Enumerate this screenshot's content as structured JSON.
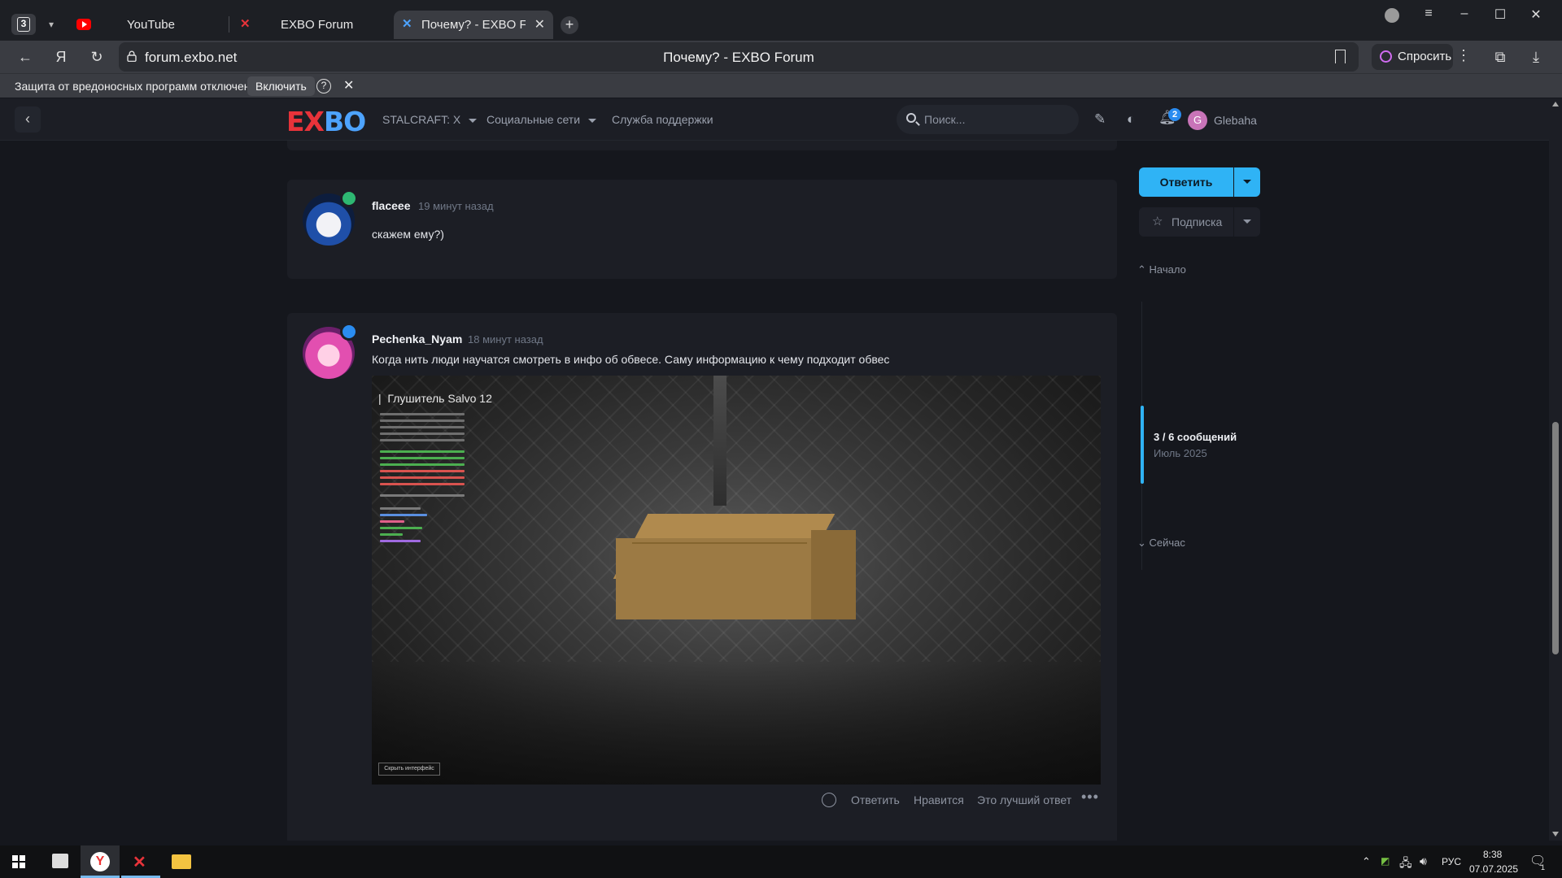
{
  "browser": {
    "tab_counter": "3",
    "tabs": [
      {
        "label": "YouTube"
      },
      {
        "label": "EXBO Forum"
      },
      {
        "label": "Почему? - EXBO Forum"
      }
    ],
    "address": {
      "url": "forum.exbo.net",
      "page_title": "Почему? - EXBO Forum"
    },
    "ask_button": "Спросить",
    "warning": {
      "text": "Защита от вредоносных программ отключена",
      "enable_button": "Включить",
      "help": "?"
    }
  },
  "forum": {
    "logo_left": "EX",
    "logo_right": "BO",
    "nav": [
      {
        "label": "STALCRAFT: X"
      },
      {
        "label": "Социальные сети"
      },
      {
        "label": "Служба поддержки"
      }
    ],
    "search_placeholder": "Поиск...",
    "notifications_count": "2",
    "user": {
      "initial": "G",
      "name": "Glebaha"
    }
  },
  "posts": [
    {
      "author": "flaceee",
      "time": "19 минут назад",
      "text": "скажем ему?)"
    },
    {
      "author": "Pechenka_Nyam",
      "time": "18 минут назад",
      "text": "Когда нить люди научатся смотреть в инфо об обвесе. Саму информацию к чему подходит обвес",
      "image": {
        "hud_title": "Глушитель Salvo 12",
        "hud_button": "Скрыть интерфейс"
      },
      "actions": [
        "Ответить",
        "Нравится",
        "Это лучший ответ"
      ]
    }
  ],
  "sidebar": {
    "reply_button": "Ответить",
    "subscribe_button": "Подписка",
    "scrubber": {
      "start": "Начало",
      "count": "3 / 6 сообщений",
      "date": "Июль 2025",
      "now": "Сейчас",
      "position_fraction": 0.5
    }
  },
  "taskbar": {
    "language": "РУС",
    "time": "8:38",
    "date": "07.07.2025",
    "notification_count": "1"
  },
  "colors": {
    "accent": "#2fb3f5",
    "logo_red": "#e8333a",
    "logo_blue": "#4da3ff",
    "panel": "#1c1e25",
    "background": "#15171d"
  }
}
